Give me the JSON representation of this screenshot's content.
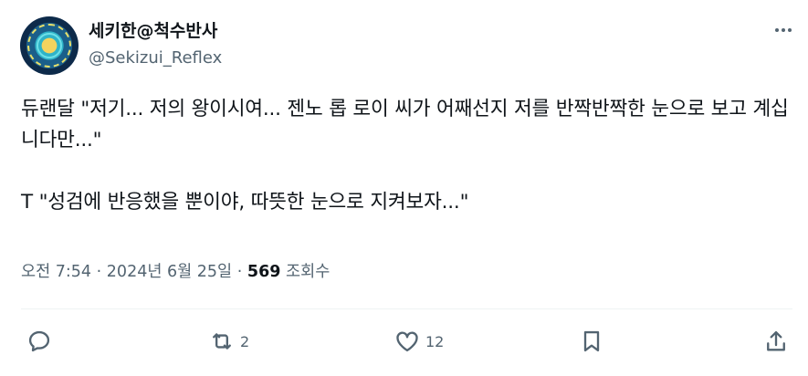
{
  "author": {
    "display_name": "세키한@척수반사",
    "handle": "@Sekizui_Reflex"
  },
  "tweet": {
    "text": "듀랜달 \"저기... 저의 왕이시여... 젠노 롭 로이 씨가 어째선지 저를 반짝반짝한 눈으로 보고 계십니다만...\"\n\nT \"성검에 반응했을 뿐이야, 따뜻한 눈으로 지켜보자...\""
  },
  "meta": {
    "time": "오전 7:54",
    "sep1": "·",
    "date": "2024년 6월 25일",
    "sep2": "·",
    "views_count": "569",
    "views_label": "조회수"
  },
  "actions": {
    "reply_count": "",
    "retweet_count": "2",
    "like_count": "12"
  },
  "icons": {
    "more": "more-icon",
    "reply": "reply-icon",
    "retweet": "retweet-icon",
    "like": "heart-icon",
    "bookmark": "bookmark-icon",
    "share": "share-icon"
  },
  "colors": {
    "text_primary": "#0f1419",
    "text_secondary": "#536471",
    "divider": "#eff3f4"
  }
}
